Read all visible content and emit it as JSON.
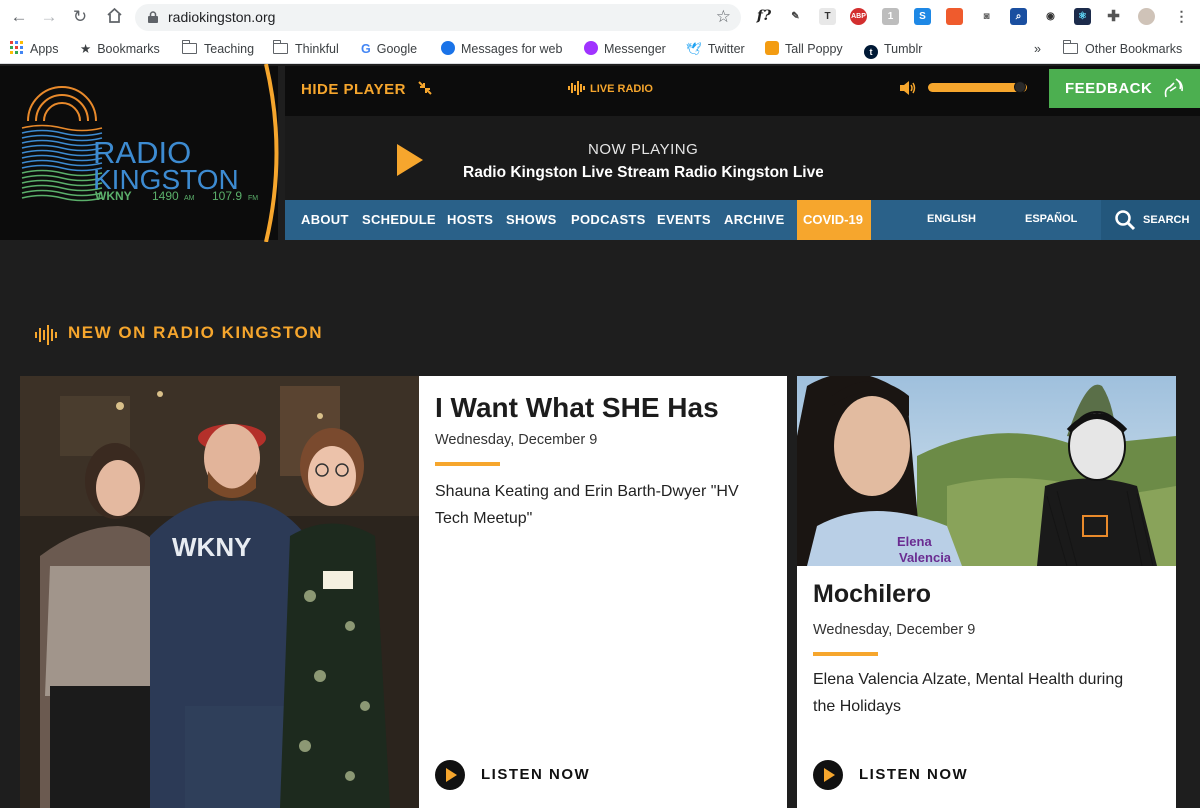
{
  "browser": {
    "url": "radiokingston.org",
    "bookmarks": [
      {
        "label": "Apps"
      },
      {
        "label": "Bookmarks"
      },
      {
        "label": "Teaching"
      },
      {
        "label": "Thinkful"
      },
      {
        "label": "Google"
      },
      {
        "label": "Messages for web"
      },
      {
        "label": "Messenger"
      },
      {
        "label": "Twitter"
      },
      {
        "label": "Tall Poppy"
      },
      {
        "label": "Tumblr"
      }
    ],
    "overflow": "»",
    "other_bookmarks": "Other Bookmarks",
    "ext_f": "f?",
    "ext_abp": "ABP"
  },
  "logo": {
    "line1": "RADIO",
    "line2": "KINGSTON",
    "call": "WKNY",
    "freq1": "1490",
    "freq1_unit": "AM",
    "freq2": "107.9",
    "freq2_unit": "FM"
  },
  "player": {
    "hide_label": "HIDE PLAYER",
    "live_label": "LIVE RADIO",
    "volume_level": 0.93,
    "feedback_label": "FEEDBACK",
    "now_playing_label": "NOW PLAYING",
    "now_track": "Radio Kingston Live Stream  Radio Kingston Live Stream"
  },
  "nav": {
    "items": [
      "ABOUT",
      "SCHEDULE",
      "HOSTS",
      "SHOWS",
      "PODCASTS",
      "EVENTS",
      "ARCHIVE"
    ],
    "covid": "COVID-19",
    "english": "ENGLISH",
    "espanol": "ESPAÑOL",
    "search": "SEARCH"
  },
  "section": {
    "title": "NEW ON RADIO KINGSTON"
  },
  "cards": [
    {
      "title": "I Want What SHE Has",
      "date": "Wednesday, December 9",
      "description": "Shauna Keating and Erin Barth-Dwyer \"HV Tech Meetup\"",
      "listen": "LISTEN NOW",
      "photo_text": "WKNY"
    },
    {
      "title": "Mochilero",
      "date": "Wednesday, December 9",
      "description": "Elena Valencia Alzate, Mental Health during the Holidays",
      "listen": "LISTEN NOW",
      "photo_name_line1": "Elena",
      "photo_name_line2": "Valencia"
    }
  ],
  "colors": {
    "accent": "#f6a62d",
    "nav": "#2a6189",
    "feedback": "#4caf50",
    "logo_blue": "#3d8bd1",
    "logo_green": "#5bb06b"
  }
}
